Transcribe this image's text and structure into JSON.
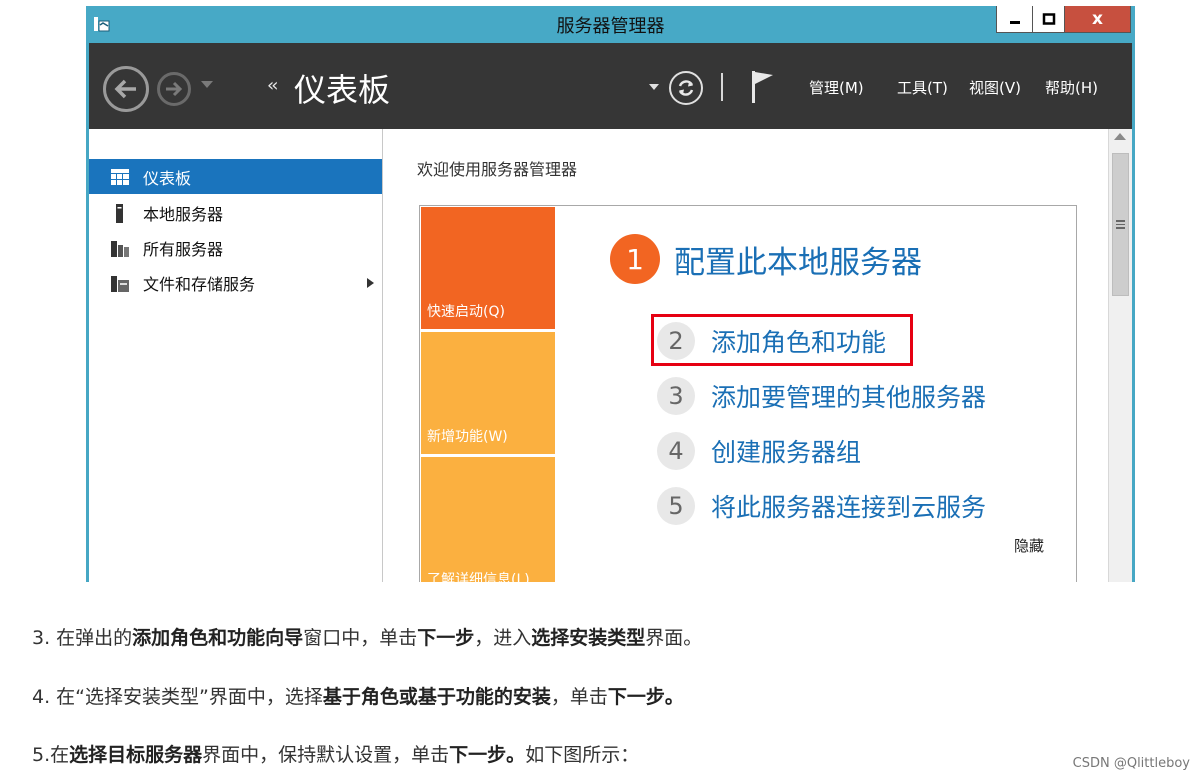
{
  "window": {
    "title": "服务器管理器",
    "close_label": "x"
  },
  "toolbar": {
    "breadcrumb_arrows": "‹‹",
    "breadcrumb_title": "仪表板",
    "menus": [
      "管理(M)",
      "工具(T)",
      "视图(V)",
      "帮助(H)"
    ]
  },
  "sidebar": {
    "items": [
      {
        "label": "仪表板",
        "icon": "dashboard-icon",
        "active": true
      },
      {
        "label": "本地服务器",
        "icon": "local-server-icon"
      },
      {
        "label": "所有服务器",
        "icon": "all-servers-icon"
      },
      {
        "label": "文件和存储服务",
        "icon": "file-storage-icon",
        "has_submenu": true
      }
    ]
  },
  "main": {
    "welcome": "欢迎使用服务器管理器",
    "tiles": [
      "快速启动(Q)",
      "新增功能(W)",
      "了解详细信息(L)"
    ],
    "step1": {
      "num": "1",
      "label": "配置此本地服务器"
    },
    "steps": [
      {
        "num": "2",
        "label": "添加角色和功能"
      },
      {
        "num": "3",
        "label": "添加要管理的其他服务器"
      },
      {
        "num": "4",
        "label": "创建服务器组"
      },
      {
        "num": "5",
        "label": "将此服务器连接到云服务"
      }
    ],
    "hide": "隐藏"
  },
  "article": {
    "p3": [
      "3. 在弹出的",
      "添加角色和功能向导",
      "窗口中，单击",
      "下一步",
      "，进入",
      "选择安装类型",
      "界面。"
    ],
    "p4": [
      "4. 在“选择安装类型”界面中，选择",
      "基于角色或基于功能的安装",
      "，单击",
      "下一步。"
    ],
    "p5": [
      "5.在",
      "选择目标服务器",
      "界面中，保持默认设置，单击",
      "下一步。",
      "如下图所示："
    ]
  },
  "watermark": "CSDN @Qlittleboy",
  "colors": {
    "titlebar": "#47a9c6",
    "toolbar": "#363636",
    "active_nav": "#1a74bd",
    "orange": "#f26522",
    "amber": "#fbb040",
    "link_blue": "#1a6fb5",
    "highlight_red": "#e60012"
  }
}
